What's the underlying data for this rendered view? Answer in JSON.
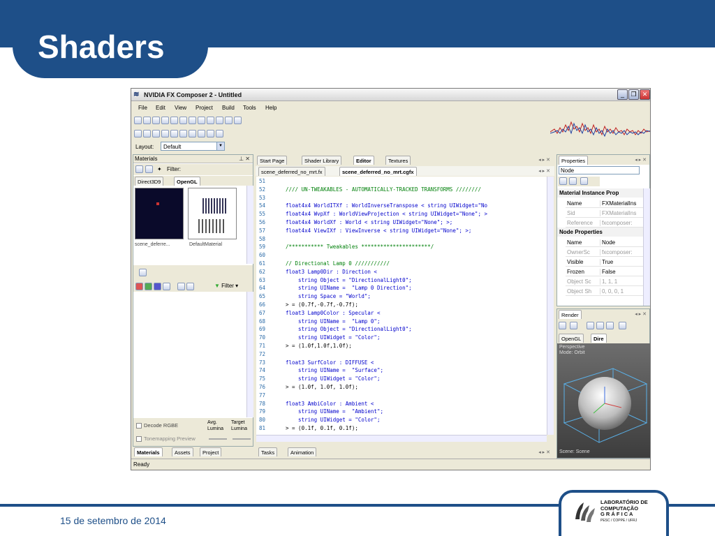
{
  "slide": {
    "title": "Shaders",
    "date": "15 de setembro de 2014",
    "logo_lines": [
      "LABORATÓRIO DE",
      "COMPUTAÇÃO",
      "G R Á F I C A",
      "PESC / COPPE / UFRJ"
    ]
  },
  "app": {
    "window_title": "NVIDIA FX Composer 2 - Untitled",
    "menu": [
      "File",
      "Edit",
      "View",
      "Project",
      "Build",
      "Tools",
      "Help"
    ],
    "layout_label": "Layout:",
    "layout_value": "Default",
    "status": "Ready",
    "materials_panel": {
      "title": "Materials",
      "filter_label": "Filter:",
      "tabs": [
        "Direct3D9",
        "OpenGL"
      ],
      "thumbs": [
        "scene_deferre...",
        "DefaultMaterial"
      ],
      "filter_btn": "Filter",
      "decode_label": "Decode RGBE",
      "tonemap_label": "Tonemapping Preview",
      "avg_label": "Avg. Lumina",
      "target_label": "Target Lumina",
      "bottom_tabs": [
        "Materials",
        "Assets",
        "Project"
      ]
    },
    "editor": {
      "doc_tabs": [
        "Start Page",
        "Shader Library",
        "Editor",
        "Textures"
      ],
      "file_tabs": [
        "scene_deferred_no_mrt.fx",
        "scene_deferred_no_mrt.cgfx"
      ],
      "lines": [
        {
          "n": "51",
          "t": ""
        },
        {
          "n": "52",
          "t": "//// UN-TWEAKABLES - AUTOMATICALLY-TRACKED TRANSFORMS ////////"
        },
        {
          "n": "53",
          "t": ""
        },
        {
          "n": "54",
          "t": "float4x4 WorldITXf : WorldInverseTranspose < string UIWidget=\"No"
        },
        {
          "n": "55",
          "t": "float4x4 WvpXf : WorldViewProjection < string UIWidget=\"None\"; >"
        },
        {
          "n": "56",
          "t": "float4x4 WorldXf : World < string UIWidget=\"None\"; >;"
        },
        {
          "n": "57",
          "t": "float4x4 ViewIXf : ViewInverse < string UIWidget=\"None\"; >;"
        },
        {
          "n": "58",
          "t": ""
        },
        {
          "n": "59",
          "t": "/*********** Tweakables **********************/"
        },
        {
          "n": "60",
          "t": ""
        },
        {
          "n": "61",
          "t": "// Directional Lamp 0 ///////////"
        },
        {
          "n": "62",
          "t": "float3 Lamp0Dir : Direction <"
        },
        {
          "n": "63",
          "t": "    string Object = \"DirectionalLight0\";"
        },
        {
          "n": "64",
          "t": "    string UIName =  \"Lamp 0 Direction\";"
        },
        {
          "n": "65",
          "t": "    string Space = \"World\";"
        },
        {
          "n": "66",
          "t": "> = (0.7f,-0.7f,-0.7f);"
        },
        {
          "n": "67",
          "t": "float3 Lamp0Color : Specular <"
        },
        {
          "n": "68",
          "t": "    string UIName =  \"Lamp 0\";"
        },
        {
          "n": "69",
          "t": "    string Object = \"DirectionalLight0\";"
        },
        {
          "n": "70",
          "t": "    string UIWidget = \"Color\";"
        },
        {
          "n": "71",
          "t": "> = (1.0f,1.0f,1.0f);"
        },
        {
          "n": "72",
          "t": ""
        },
        {
          "n": "73",
          "t": "float3 SurfColor : DIFFUSE <"
        },
        {
          "n": "74",
          "t": "    string UIName =  \"Surface\";"
        },
        {
          "n": "75",
          "t": "    string UIWidget = \"Color\";"
        },
        {
          "n": "76",
          "t": "> = (1.0f, 1.0f, 1.0f);"
        },
        {
          "n": "77",
          "t": ""
        },
        {
          "n": "78",
          "t": "float3 AmbiColor : Ambient <"
        },
        {
          "n": "79",
          "t": "    string UIName =  \"Ambient\";"
        },
        {
          "n": "80",
          "t": "    string UIWidget = \"Color\";"
        },
        {
          "n": "81",
          "t": "> = (0.1f, 0.1f, 0.1f);"
        }
      ],
      "bottom_tabs": [
        "Tasks",
        "Animation"
      ]
    },
    "properties": {
      "title": "Properties",
      "node_select": "Node",
      "cat1": "Material Instance Prop",
      "rows1": [
        {
          "k": "Name",
          "v": "FXMaterialIns",
          "dim": false
        },
        {
          "k": "Sid",
          "v": "FXMaterialIns",
          "dim": true
        },
        {
          "k": "Reference",
          "v": "fxcomposer:",
          "dim": true
        }
      ],
      "cat2": "Node Properties",
      "rows2": [
        {
          "k": "Name",
          "v": "Node",
          "dim": false
        },
        {
          "k": "OwnerSc",
          "v": "fxcomposer:",
          "dim": true
        },
        {
          "k": "Visible",
          "v": "True",
          "dim": false
        },
        {
          "k": "Frozen",
          "v": "False",
          "dim": false
        },
        {
          "k": "Object Sc",
          "v": "1, 1, 1",
          "dim": true
        },
        {
          "k": "Object Sh",
          "v": "0, 0, 0, 1",
          "dim": true
        }
      ]
    },
    "render": {
      "title": "Render",
      "tabs": [
        "OpenGL",
        "Dire"
      ],
      "perspective": "Perspective",
      "mode": "Mode: Orbit",
      "scene": "Scene: Scene"
    }
  }
}
